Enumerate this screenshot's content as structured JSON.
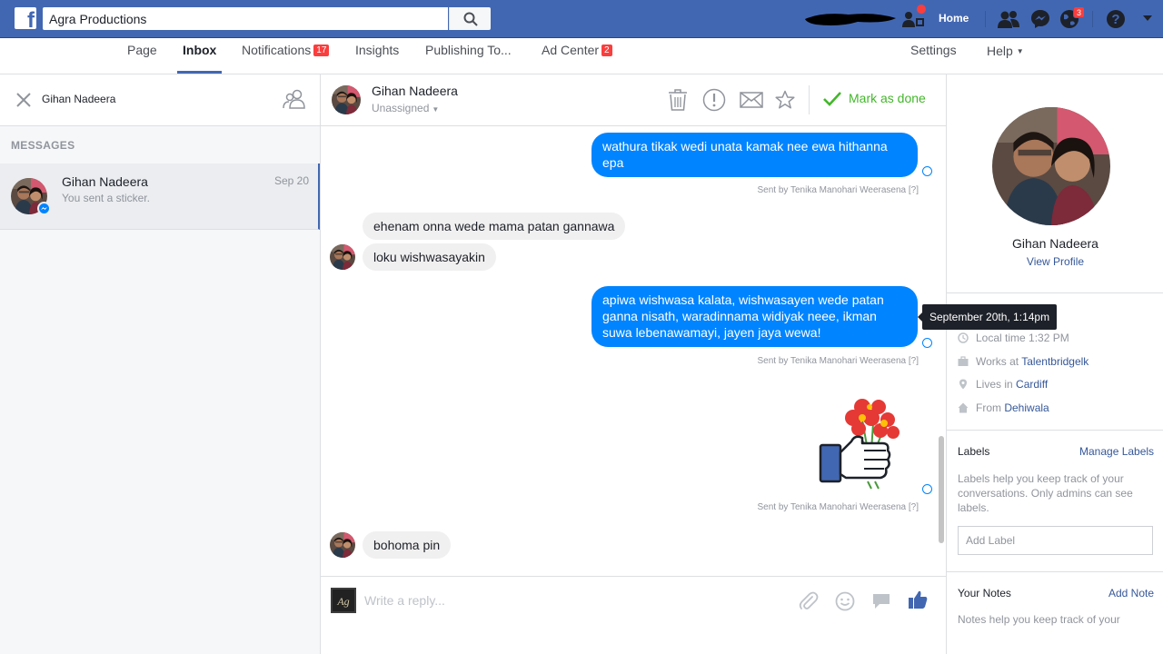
{
  "topbar": {
    "logo_letter": "f",
    "search_value": "Agra Productions",
    "home_label": "Home",
    "notifications_count": "3"
  },
  "pagenav": {
    "page": "Page",
    "inbox": "Inbox",
    "notifications": "Notifications",
    "notifications_badge": "17",
    "insights": "Insights",
    "publishing": "Publishing To...",
    "ad_center": "Ad Center",
    "ad_center_badge": "2",
    "settings": "Settings",
    "help": "Help"
  },
  "left": {
    "search_text": "Gihan Nadeera",
    "section_label": "MESSAGES",
    "thread": {
      "name": "Gihan Nadeera",
      "snippet": "You sent a sticker.",
      "date": "Sep 20"
    }
  },
  "conversation": {
    "name": "Gihan Nadeera",
    "assignment": "Unassigned",
    "mark_done": "Mark as done",
    "messages": [
      {
        "dir": "out",
        "text": "wathura tikak wedi unata kamak nee ewa hithanna epa",
        "sent_by": "Sent by Tenika Manohari Weerasena [?]"
      },
      {
        "dir": "in",
        "text": "ehenam onna wede mama patan gannawa"
      },
      {
        "dir": "in",
        "text": "loku wishwasayakin"
      },
      {
        "dir": "out",
        "text": "apiwa wishwasa kalata, wishwasayen wede patan ganna nisath, waradinnama widiyak neee, ikman suwa lebenawamayi, jayen jaya wewa!",
        "sent_by": "Sent by Tenika Manohari Weerasena [?]"
      },
      {
        "dir": "out",
        "sticker": "flowers-thumbs-up-sticker",
        "sent_by": "Sent by Tenika Manohari Weerasena [?]"
      },
      {
        "dir": "in",
        "text": "bohoma pin"
      }
    ],
    "reply_placeholder": "Write a reply...",
    "tooltip": "September 20th, 1:14pm"
  },
  "profile": {
    "name": "Gihan Nadeera",
    "view_profile": "View Profile",
    "local_time": "Local time 1:32 PM",
    "works_prefix": "Works at ",
    "works_at": "Talentbridgelk",
    "lives_prefix": "Lives in ",
    "lives_in": "Cardiff",
    "from_prefix": "From ",
    "from": "Dehiwala"
  },
  "labels": {
    "title": "Labels",
    "manage": "Manage Labels",
    "help": "Labels help you keep track of your conversations. Only admins can see labels.",
    "add_placeholder": "Add Label"
  },
  "notes": {
    "title": "Your Notes",
    "add": "Add Note",
    "help": "Notes help you keep track of your"
  },
  "colors": {
    "brand_blue": "#4267b2",
    "messenger_blue": "#0084ff",
    "done_green": "#42b72a",
    "badge_red": "#fa3e3e"
  }
}
